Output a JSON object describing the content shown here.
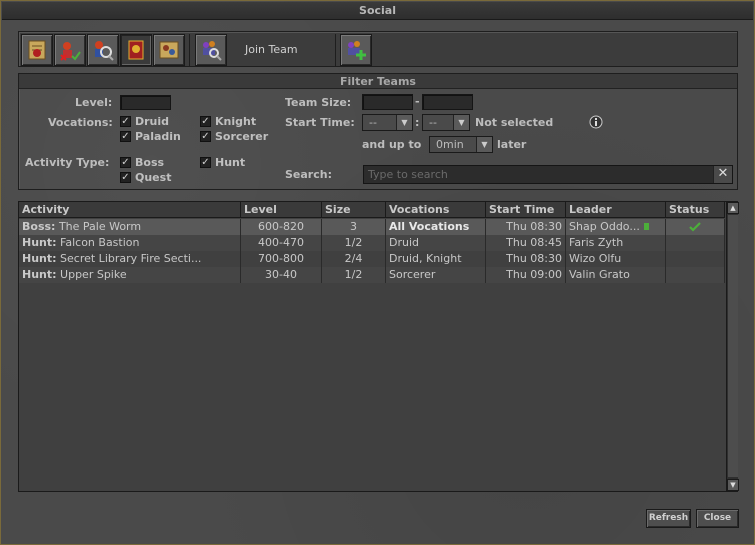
{
  "window": {
    "title": "Social"
  },
  "toolbar": {
    "join_team_label": "Join Team",
    "buttons": [
      {
        "icon": "scroll-icon"
      },
      {
        "icon": "remove-member-icon"
      },
      {
        "icon": "search-member-icon"
      },
      {
        "icon": "banner-icon"
      },
      {
        "icon": "map-icon"
      },
      {
        "icon": "join-team-icon"
      },
      {
        "icon": "create-team-icon"
      }
    ]
  },
  "filter": {
    "heading": "Filter Teams",
    "level_label": "Level:",
    "level_value": "",
    "vocations_label": "Vocations:",
    "vocations": [
      "Druid",
      "Knight",
      "Paladin",
      "Sorcerer"
    ],
    "activity_type_label": "Activity Type:",
    "activity_types": [
      "Boss",
      "Hunt",
      "Quest"
    ],
    "team_size_label": "Team Size:",
    "team_size_separator": "-",
    "start_time_label": "Start Time:",
    "start_hour": "--",
    "start_minute": "--",
    "time_separator": ":",
    "not_selected": "Not selected",
    "and_up_to_label": "and up to",
    "up_to_value": "0min",
    "later_label": "later",
    "search_label": "Search:",
    "search_placeholder": "Type to search"
  },
  "table": {
    "columns": [
      "Activity",
      "Level",
      "Size",
      "Vocations",
      "Start Time",
      "Leader",
      "Status"
    ],
    "rows": [
      {
        "type": "Boss:",
        "name": "The Pale Worm",
        "level": "600-820",
        "size": "3",
        "vocations": "All Vocations",
        "start": "Thu 08:30",
        "leader": "Shap Oddo...",
        "status": "check"
      },
      {
        "type": "Hunt:",
        "name": "Falcon Bastion",
        "level": "400-470",
        "size": "1/2",
        "vocations": "Druid",
        "start": "Thu 08:45",
        "leader": "Faris Zyth",
        "status": ""
      },
      {
        "type": "Hunt:",
        "name": "Secret Library Fire Secti...",
        "level": "700-800",
        "size": "2/4",
        "vocations": "Druid, Knight",
        "start": "Thu 08:30",
        "leader": "Wizo Olfu",
        "status": ""
      },
      {
        "type": "Hunt:",
        "name": "Upper Spike",
        "level": "30-40",
        "size": "1/2",
        "vocations": "Sorcerer",
        "start": "Thu 09:00",
        "leader": "Valin Grato",
        "status": ""
      }
    ]
  },
  "footer": {
    "refresh_label": "Refresh",
    "close_label": "Close"
  },
  "colors": {
    "check": "#4caf3a",
    "online": "#4caf3a"
  }
}
